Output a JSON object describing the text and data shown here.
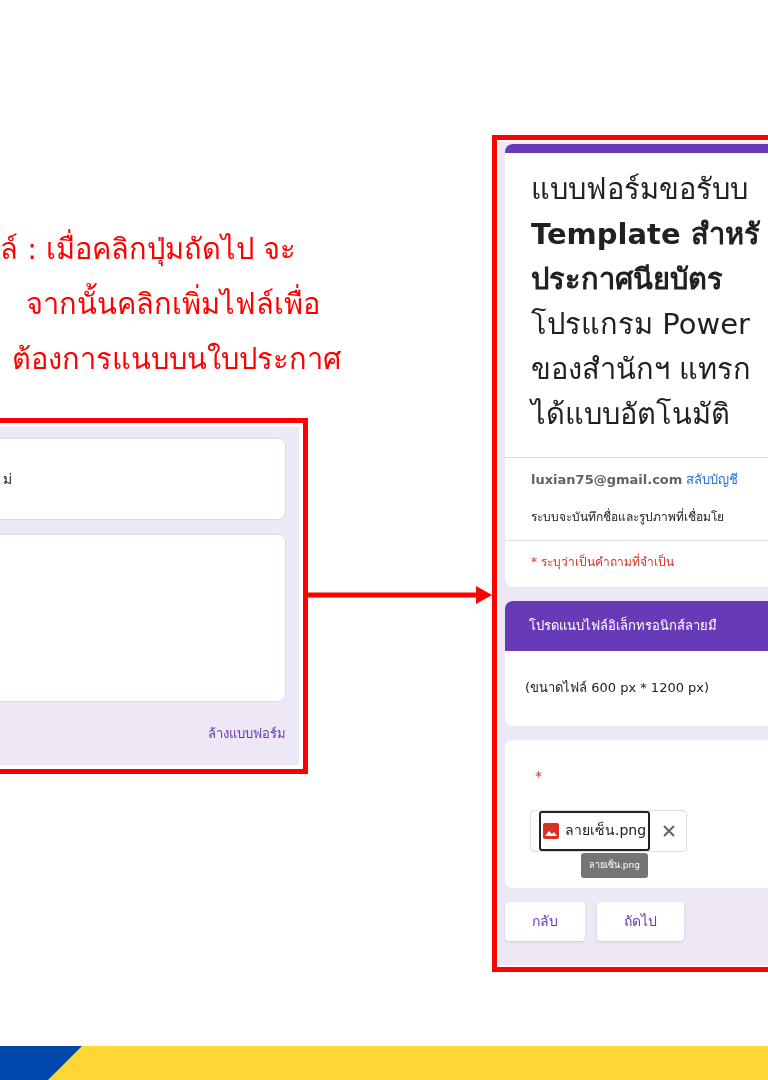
{
  "instruction_lines": [
    "ล์ : เมื่อคลิกปุ่มถัดไป จะ",
    "จากนั้นคลิกเพิ่มไฟล์เพื่อ",
    "ต้องการแนบบนใบประกาศ"
  ],
  "left_form": {
    "first_card_text": "ม่",
    "clear_link": "ล้างแบบฟอร์ม"
  },
  "right_form": {
    "title_lines": [
      "แบบฟอร์มขอรับบ",
      "**Template สำหรั**",
      "**ประกาศนียบัตร**",
      "โปรแกรม Power",
      "ของสำนักฯ แทรก",
      "ได้แบบอัตโนมัติ"
    ],
    "account_email": "luxian75@gmail.com",
    "switch_account": "สลับบัญชี",
    "notice": "ระบบจะบันทึกชื่อและรูปภาพที่เชื่อมโย",
    "required_note": "* ระบุว่าเป็นคำถามที่จำเป็น",
    "section_title": "โปรดแนบไฟล์อิเล็กทรอนิกส์ลายมื",
    "section_description": "(ขนาดไฟล์ 600 px * 1200 px)",
    "required_mark": "*",
    "file": {
      "name": "ลายเซ็น.png",
      "tooltip": "ลายเซ็น.png",
      "focused": true
    },
    "buttons": [
      {
        "label": "กลับ"
      },
      {
        "label": "ถัดไป"
      }
    ]
  }
}
